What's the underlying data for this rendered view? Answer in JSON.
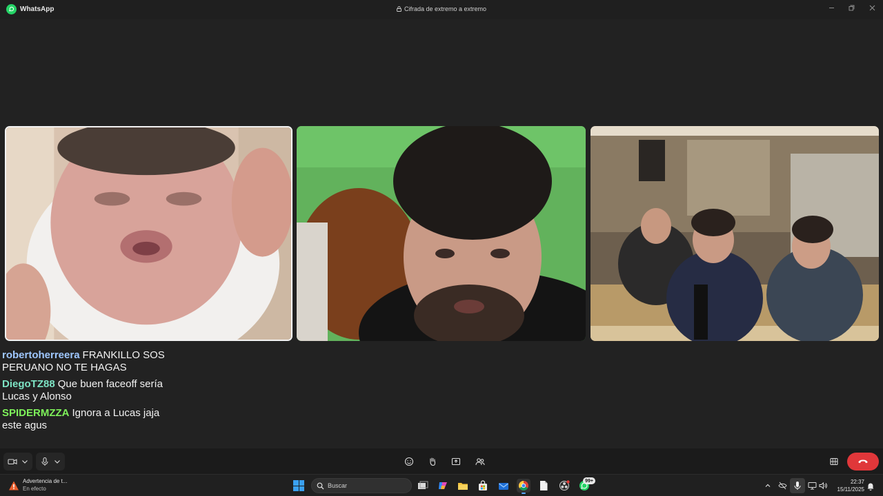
{
  "window": {
    "app_name": "WhatsApp",
    "encryption_label": "Cifrada de extremo a extremo",
    "brand_color": "#25d366"
  },
  "call": {
    "participants": [
      {
        "tile": "participant-1",
        "active_speaker": true
      },
      {
        "tile": "participant-2",
        "active_speaker": false
      },
      {
        "tile": "participant-3",
        "active_speaker": false
      }
    ],
    "controls": [
      "camera-icon",
      "chevron-down-icon",
      "microphone-icon",
      "chevron-down-icon",
      "emoji-icon",
      "raise-hand-icon",
      "share-screen-icon",
      "participants-icon",
      "grid-layout-icon",
      "end-call-icon"
    ],
    "end_call_color": "#e0373a"
  },
  "chat_overlay": [
    {
      "user": "robertoherreera",
      "text": "FRANKILLO SOS PERUANO NO TE HAGAS",
      "user_color": "#9fc7ff"
    },
    {
      "user": "DiegoTZ88",
      "text": "Que buen faceoff sería Lucas y Alonso",
      "user_color": "#7de3c4"
    },
    {
      "user": "SPIDERMZZA",
      "text": "Ignora a Lucas jaja este agus",
      "user_color": "#7ef25a"
    }
  ],
  "taskbar": {
    "notification_title": "Advertencia de t...",
    "notification_subtitle": "En efecto",
    "search_placeholder": "Buscar",
    "whatsapp_badge": "99+",
    "time": "22:37",
    "date": "15/11/2025",
    "apps": [
      "task-view-icon",
      "copilot-icon",
      "file-explorer-icon",
      "store-icon",
      "mail-icon",
      "chrome-icon",
      "notepad-icon",
      "obs-icon",
      "whatsapp-icon"
    ]
  }
}
